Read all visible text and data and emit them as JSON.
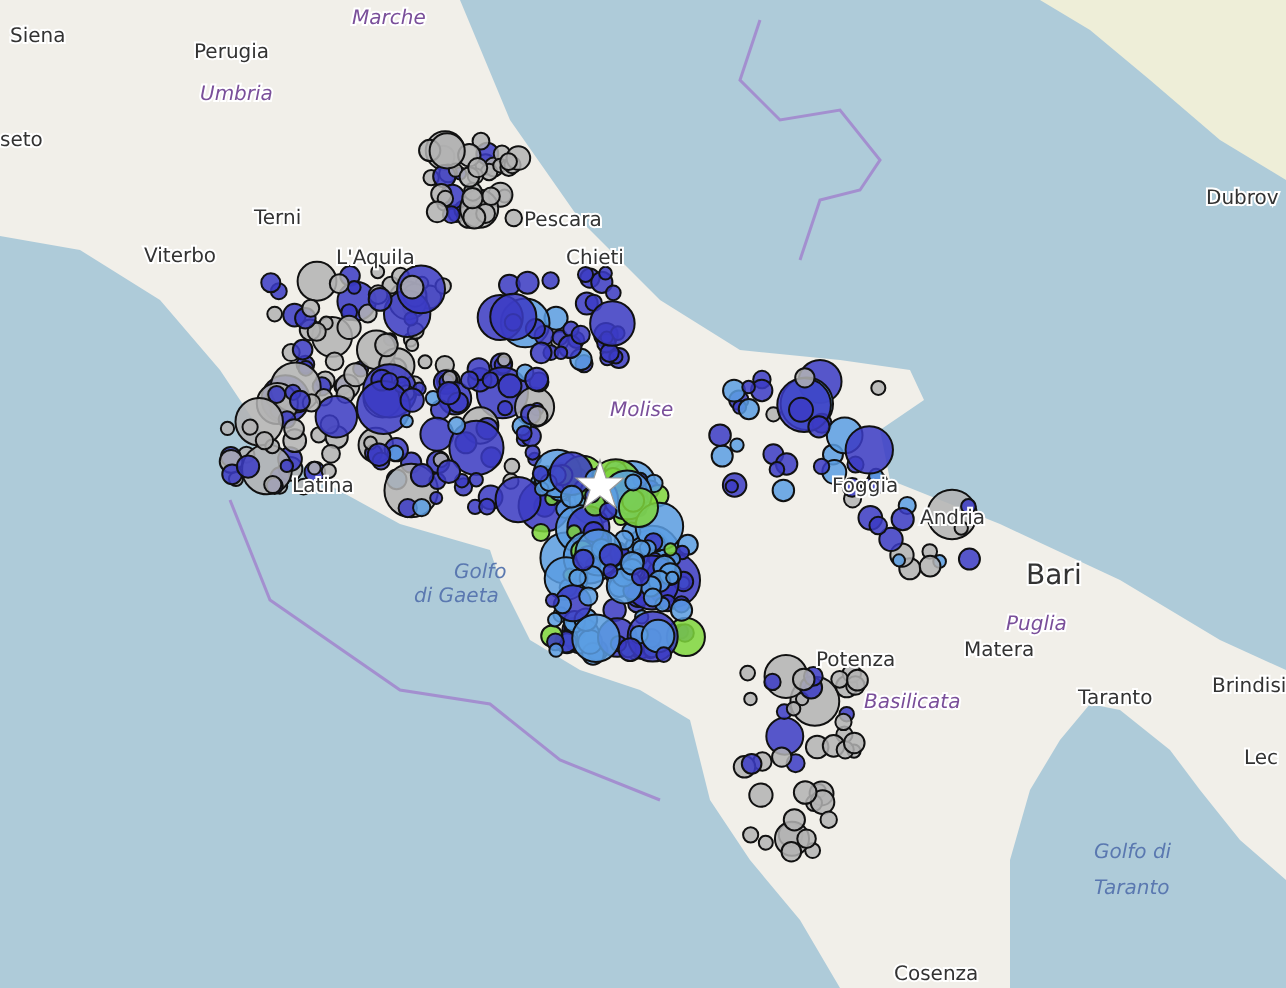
{
  "map": {
    "labels": [
      {
        "text": "Marche",
        "kind": "region"
      },
      {
        "text": "Siena",
        "kind": "city"
      },
      {
        "text": "Perugia",
        "kind": "city"
      },
      {
        "text": "Umbria",
        "kind": "region"
      },
      {
        "text": "seto",
        "kind": "city"
      },
      {
        "text": "Terni",
        "kind": "city"
      },
      {
        "text": "Viterbo",
        "kind": "city"
      },
      {
        "text": "L'Aquila",
        "kind": "city"
      },
      {
        "text": "Pescara",
        "kind": "city"
      },
      {
        "text": "Chieti",
        "kind": "city"
      },
      {
        "text": "Latina",
        "kind": "city"
      },
      {
        "text": "Molise",
        "kind": "region"
      },
      {
        "text": "Golfo",
        "kind": "sea"
      },
      {
        "text": "di Gaeta",
        "kind": "sea"
      },
      {
        "text": "Foggia",
        "kind": "city"
      },
      {
        "text": "Andria",
        "kind": "city"
      },
      {
        "text": "Bari",
        "kind": "bigcity"
      },
      {
        "text": "Puglia",
        "kind": "region"
      },
      {
        "text": "Matera",
        "kind": "city"
      },
      {
        "text": "Potenza",
        "kind": "city"
      },
      {
        "text": "Basilicata",
        "kind": "region"
      },
      {
        "text": "Taranto",
        "kind": "city"
      },
      {
        "text": "Brindisi",
        "kind": "city"
      },
      {
        "text": "Lec",
        "kind": "city"
      },
      {
        "text": "Golfo di",
        "kind": "sea"
      },
      {
        "text": "Taranto",
        "kind": "sea"
      },
      {
        "text": "Cosenza",
        "kind": "city"
      },
      {
        "text": "Dubrov",
        "kind": "city"
      }
    ]
  }
}
